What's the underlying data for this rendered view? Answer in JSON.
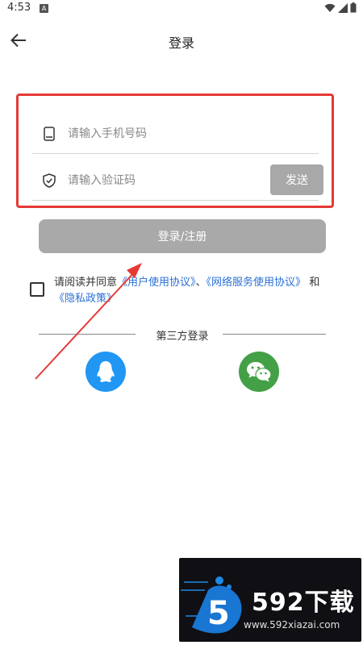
{
  "status_bar": {
    "time": "4:53",
    "notification_letter": "A"
  },
  "header": {
    "title": "登录"
  },
  "form": {
    "phone_placeholder": "请输入手机号码",
    "code_placeholder": "请输入验证码",
    "send_label": "发送"
  },
  "login_button": {
    "label": "登录/注册"
  },
  "agreement": {
    "prefix": "请阅读并同意",
    "user_agreement": "《用户使用协议》",
    "separator": "、",
    "network_agreement": "《网络服务使用协议》",
    "and": " 和 ",
    "privacy_policy": "《隐私政策》"
  },
  "third_party": {
    "label": "第三方登录"
  },
  "watermark": {
    "brand": "592下载",
    "url": "www.592xiazai.com",
    "logo_digit": "5"
  },
  "colors": {
    "highlight": "#e53935",
    "link": "#2a6fd6",
    "qq": "#2196f3",
    "wechat": "#43a047",
    "disabled_button": "#a9a9a9"
  }
}
